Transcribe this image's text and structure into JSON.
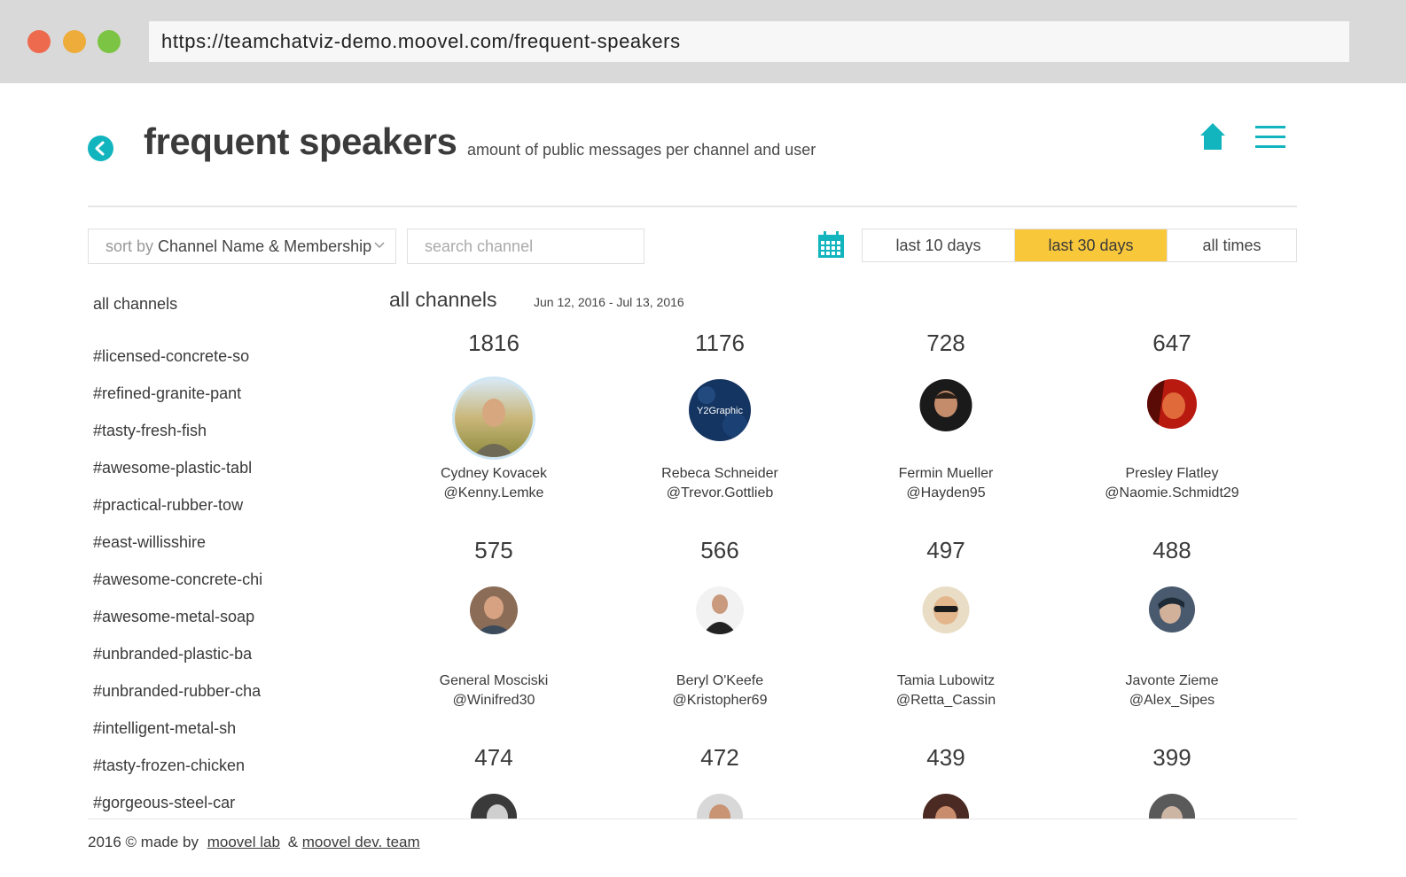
{
  "browser": {
    "url": "https://teamchatviz-demo.moovel.com/frequent-speakers"
  },
  "header": {
    "title": "frequent speakers",
    "subtitle": "amount of public messages per channel and user",
    "back_icon": "back-arrow-icon",
    "home_icon": "home-icon",
    "menu_icon": "hamburger-menu-icon"
  },
  "controls": {
    "sort_prefix": "sort by",
    "sort_value": "Channel Name & Membership",
    "search_placeholder": "search channel",
    "ranges": [
      "last 10 days",
      "last 30 days",
      "all times"
    ],
    "active_range": "last 30 days",
    "accent_color": "#f9c73a",
    "brand_color": "#12b5be"
  },
  "sidebar": {
    "all": "all channels",
    "channels": [
      "#licensed-concrete-so",
      "#refined-granite-pant",
      "#tasty-fresh-fish",
      "#awesome-plastic-tabl",
      "#practical-rubber-tow",
      "#east-willisshire",
      "#awesome-concrete-chi",
      "#awesome-metal-soap",
      "#unbranded-plastic-ba",
      "#unbranded-rubber-cha",
      "#intelligent-metal-sh",
      "#tasty-frozen-chicken",
      "#gorgeous-steel-car"
    ]
  },
  "main": {
    "title": "all channels",
    "dates": "Jun 12, 2016 - Jul 13, 2016",
    "speakers": [
      {
        "count": "1816",
        "name": "Cydney Kovacek",
        "handle": "@Kenny.Lemke"
      },
      {
        "count": "1176",
        "name": "Rebeca Schneider",
        "handle": "@Trevor.Gottlieb",
        "avatar_text": "Y2Graphic"
      },
      {
        "count": "728",
        "name": "Fermin Mueller",
        "handle": "@Hayden95"
      },
      {
        "count": "647",
        "name": "Presley Flatley",
        "handle": "@Naomie.Schmidt29"
      },
      {
        "count": "575",
        "name": "General Mosciski",
        "handle": "@Winifred30"
      },
      {
        "count": "566",
        "name": "Beryl O'Keefe",
        "handle": "@Kristopher69"
      },
      {
        "count": "497",
        "name": "Tamia Lubowitz",
        "handle": "@Retta_Cassin"
      },
      {
        "count": "488",
        "name": "Javonte Zieme",
        "handle": "@Alex_Sipes"
      },
      {
        "count": "474"
      },
      {
        "count": "472"
      },
      {
        "count": "439"
      },
      {
        "count": "399"
      }
    ]
  },
  "footer": {
    "prefix": "2016 © made by",
    "link1": "moovel lab",
    "amp": "&",
    "link2": "moovel dev. team"
  }
}
